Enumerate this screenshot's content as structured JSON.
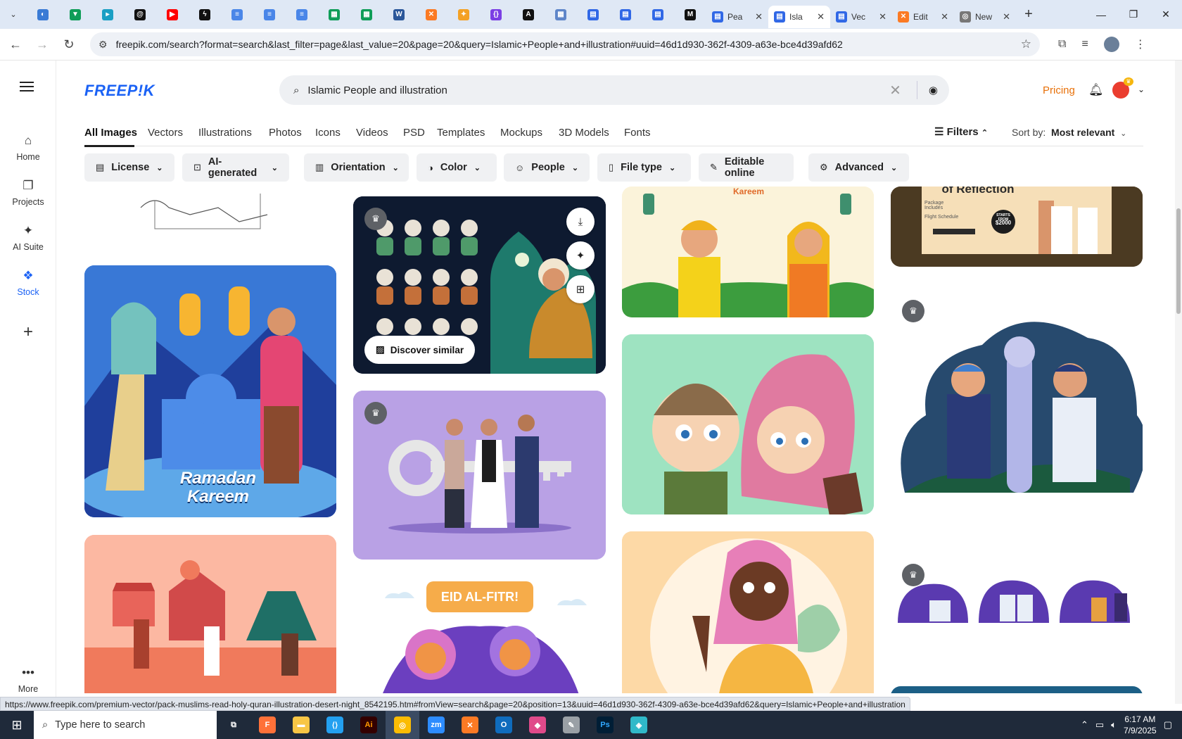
{
  "browser": {
    "tabs_pinned": [
      {
        "icon": "bluesky-icon",
        "color": "#3a7bd5"
      },
      {
        "icon": "vpn-icon",
        "color": "#0f9d58"
      },
      {
        "icon": "arrow-app-icon",
        "color": "#1a9fc4"
      },
      {
        "icon": "threads-icon",
        "color": "#111111"
      },
      {
        "icon": "youtube-icon",
        "color": "#ff0000"
      },
      {
        "icon": "bolt-icon",
        "color": "#111111"
      },
      {
        "icon": "docs-icon",
        "color": "#4a86e8"
      },
      {
        "icon": "docs-icon",
        "color": "#4a86e8"
      },
      {
        "icon": "docs-icon",
        "color": "#4a86e8"
      },
      {
        "icon": "sheets-icon",
        "color": "#0f9d58"
      },
      {
        "icon": "sheets-icon",
        "color": "#0f9d58"
      },
      {
        "icon": "word-icon",
        "color": "#2b579a"
      },
      {
        "icon": "xampp-icon",
        "color": "#fb7a24"
      },
      {
        "icon": "bird-icon",
        "color": "#f4a124"
      },
      {
        "icon": "json-icon",
        "color": "#7b3fe4"
      },
      {
        "icon": "anthropic-icon",
        "color": "#111111"
      },
      {
        "icon": "grid-icon",
        "color": "#5f86c9"
      },
      {
        "icon": "forms-icon",
        "color": "#3168e6"
      },
      {
        "icon": "forms-icon",
        "color": "#3168e6"
      },
      {
        "icon": "forms-icon",
        "color": "#3168e6"
      },
      {
        "icon": "medium-icon",
        "color": "#111111"
      }
    ],
    "tabs_named": [
      {
        "title": "Pea",
        "icon": "forms-icon",
        "active": false
      },
      {
        "title": "Isla",
        "icon": "forms-icon",
        "active": true
      },
      {
        "title": "Vec",
        "icon": "forms-icon",
        "active": false
      },
      {
        "title": "Edit",
        "icon": "xampp-icon",
        "active": false
      },
      {
        "title": "New",
        "icon": "chrome-icon",
        "active": false
      }
    ],
    "url": "freepik.com/search?format=search&last_filter=page&last_value=20&page=20&query=Islamic+People+and+illustration#uuid=46d1d930-362f-4309-a63e-bce4d39afd62",
    "status_url": "https://www.freepik.com/premium-vector/pack-muslims-read-holy-quran-illustration-desert-night_8542195.htm#fromView=search&page=20&position=13&uuid=46d1d930-362f-4309-a63e-bce4d39afd62&query=Islamic+People+and+illustration"
  },
  "sidebar": {
    "items": [
      {
        "label": "Home",
        "icon": "home-icon"
      },
      {
        "label": "Projects",
        "icon": "projects-icon"
      },
      {
        "label": "AI Suite",
        "icon": "sparkle-icon"
      },
      {
        "label": "Stock",
        "icon": "stock-icon",
        "active": true
      },
      {
        "label": "",
        "icon": "plus-icon"
      },
      {
        "label": "More",
        "icon": "more-icon"
      }
    ]
  },
  "header": {
    "logo": "FREEP!K",
    "search_value": "Islamic People and illustration",
    "pricing": "Pricing"
  },
  "categories": [
    "All Images",
    "Vectors",
    "Illustrations",
    "Photos",
    "Icons",
    "Videos",
    "PSD",
    "Templates",
    "Mockups",
    "3D Models",
    "Fonts"
  ],
  "filters_label": "Filters",
  "sort": {
    "label": "Sort by:",
    "value": "Most relevant"
  },
  "chips": [
    {
      "label": "License",
      "icon": "license-icon"
    },
    {
      "label": "AI-generated",
      "icon": "ai-icon"
    },
    {
      "label": "Orientation",
      "icon": "orientation-icon"
    },
    {
      "label": "Color",
      "icon": "palette-icon"
    },
    {
      "label": "People",
      "icon": "people-icon"
    },
    {
      "label": "File type",
      "icon": "file-icon"
    },
    {
      "label": "Editable online",
      "icon": "pencil-icon"
    },
    {
      "label": "Advanced",
      "icon": "gear-icon"
    }
  ],
  "results": {
    "discover_label": "Discover similar",
    "caption_ramadan": "Ramadan Kareem",
    "caption_eid": "EID AL-FITR!",
    "caption_kareem": "Kareem",
    "caption_reflection": "of Reflection",
    "caption_price_top": "STARTS FROM",
    "caption_price": "$2000",
    "caption_package": "Package Includes",
    "caption_flight": "Flight Schedule"
  },
  "taskbar": {
    "search_placeholder": "Type here to search",
    "time": "6:17 AM",
    "date": "7/9/2025",
    "apps": [
      {
        "icon": "task-view-icon",
        "color": "#ffffff"
      },
      {
        "icon": "firefox-icon",
        "color": "#ff7139"
      },
      {
        "icon": "file-explorer-icon",
        "color": "#f8c645"
      },
      {
        "icon": "vscode-icon",
        "color": "#23a0f0"
      },
      {
        "icon": "illustrator-icon",
        "color": "#330000"
      },
      {
        "icon": "chrome-icon",
        "color": "#fbbc04"
      },
      {
        "icon": "zoom-icon",
        "color": "#2d8cff"
      },
      {
        "icon": "xampp-icon",
        "color": "#fb7a24"
      },
      {
        "icon": "outlook-icon",
        "color": "#0f6cbd"
      },
      {
        "icon": "paint-icon",
        "color": "#e04a8a"
      },
      {
        "icon": "pen-icon",
        "color": "#9aa0a6"
      },
      {
        "icon": "photoshop-icon",
        "color": "#001e36"
      },
      {
        "icon": "vpn-app-icon",
        "color": "#2fb9c9"
      }
    ]
  }
}
